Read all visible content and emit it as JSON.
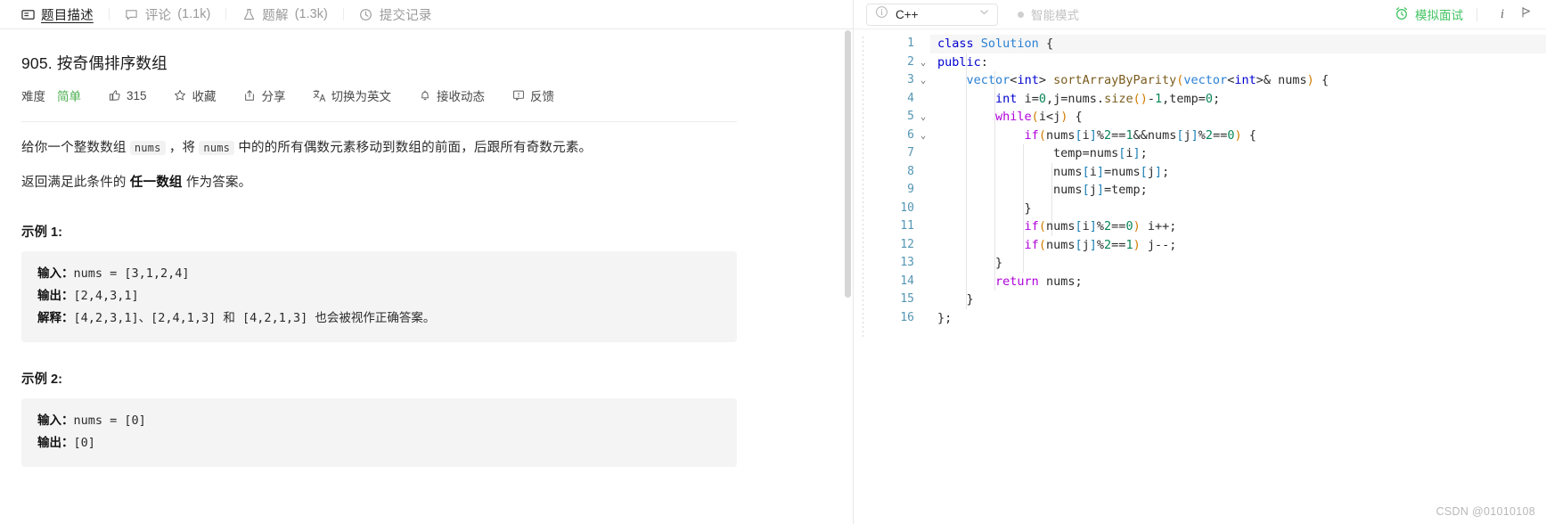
{
  "left": {
    "tabs": [
      {
        "icon": "description-icon",
        "label": "题目描述",
        "count": "",
        "active": true
      },
      {
        "icon": "comment-icon",
        "label": "评论",
        "count": "(1.1k)",
        "active": false
      },
      {
        "icon": "flask-icon",
        "label": "题解",
        "count": "(1.3k)",
        "active": false
      },
      {
        "icon": "clock-icon",
        "label": "提交记录",
        "count": "",
        "active": false
      }
    ],
    "problem": {
      "title": "905. 按奇偶排序数组",
      "difficulty_label": "难度",
      "difficulty_value": "简单",
      "difficulty_color": "#4caf50",
      "actions": [
        {
          "icon": "thumbs-up-icon",
          "label": "315",
          "name": "likes"
        },
        {
          "icon": "star-icon",
          "label": "收藏",
          "name": "favorite"
        },
        {
          "icon": "share-icon",
          "label": "分享",
          "name": "share"
        },
        {
          "icon": "translate-icon",
          "label": "切换为英文",
          "name": "switch-language"
        },
        {
          "icon": "bell-icon",
          "label": "接收动态",
          "name": "subscribe"
        },
        {
          "icon": "feedback-icon",
          "label": "反馈",
          "name": "feedback"
        }
      ],
      "desc_p1_a": "给你一个整数数组 ",
      "desc_p1_code1": "nums",
      "desc_p1_b": " ，将 ",
      "desc_p1_code2": "nums",
      "desc_p1_c": " 中的的所有偶数元素移动到数组的前面，后跟所有奇数元素。",
      "desc_p2_a": "返回满足此条件的 ",
      "desc_p2_strong": "任一数组",
      "desc_p2_b": " 作为答案。",
      "examples": [
        {
          "heading": "示例 1:",
          "lines": [
            {
              "label": "输入：",
              "value": "nums = [3,1,2,4]",
              "tail": ""
            },
            {
              "label": "输出：",
              "value": "[2,4,3,1]",
              "tail": ""
            },
            {
              "label": "解释：",
              "value": "[4,2,3,1]、[2,4,1,3] 和 [4,2,1,3] ",
              "tail": "也会被视作正确答案。"
            }
          ]
        },
        {
          "heading": "示例 2:",
          "lines": [
            {
              "label": "输入：",
              "value": "nums = [0]",
              "tail": ""
            },
            {
              "label": "输出：",
              "value": "[0]",
              "tail": ""
            }
          ]
        }
      ]
    }
  },
  "right": {
    "toolbar": {
      "language": "C++",
      "smart_mode": "智能模式",
      "mock_interview": "模拟面试",
      "info_glyph": "i",
      "run_glyph": "▷",
      "accent_green": "#43c463"
    },
    "editor": {
      "line_numbers": [
        "1",
        "2",
        "3",
        "4",
        "5",
        "6",
        "7",
        "8",
        "9",
        "10",
        "11",
        "12",
        "13",
        "14",
        "15",
        "16"
      ],
      "folds": [
        "",
        "v",
        "v",
        "",
        "v",
        "v",
        "",
        "",
        "",
        "",
        "",
        "",
        "",
        "",
        "",
        ""
      ],
      "code": [
        "class Solution {",
        "public:",
        "    vector<int> sortArrayByParity(vector<int>& nums) {",
        "        int i=0,j=nums.size()-1,temp=0;",
        "        while(i<j) {",
        "            if(nums[i]%2==1&&nums[j]%2==0) {",
        "                temp=nums[i];",
        "                nums[i]=nums[j];",
        "                nums[j]=temp;",
        "            }",
        "            if(nums[i]%2==0) i++;",
        "            if(nums[j]%2==1) j--;",
        "        }",
        "        return nums;",
        "    }",
        "};"
      ]
    }
  },
  "watermark": "CSDN @01010108"
}
